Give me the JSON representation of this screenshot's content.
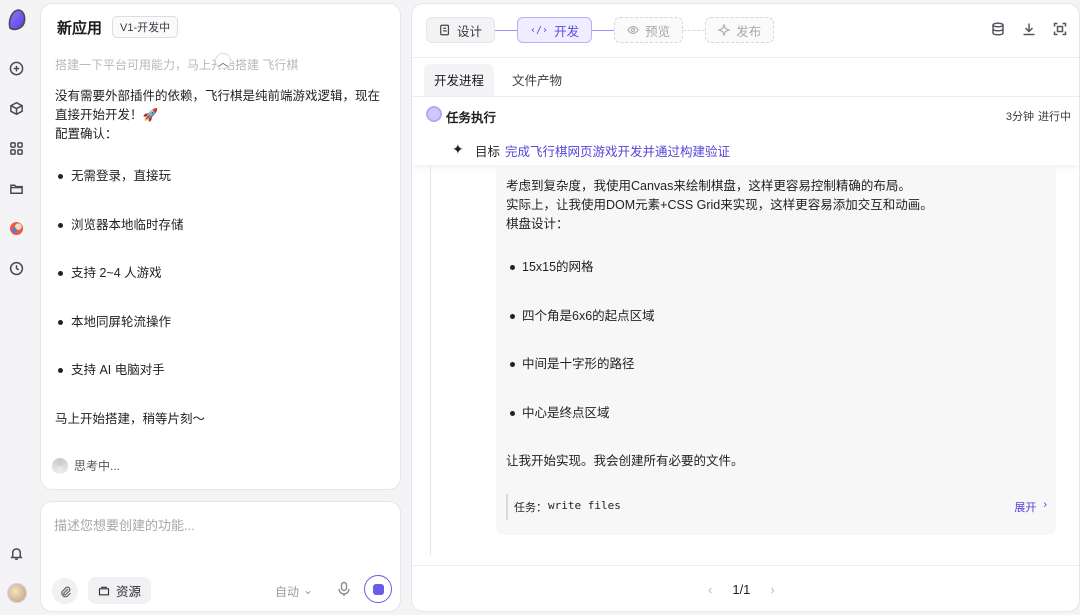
{
  "app": {
    "title": "新应用",
    "version_badge": "V1-开发中"
  },
  "chat": {
    "faded_line": "搭建一下平台可用能力，马上开始搭建 飞行棋",
    "message_intro": "没有需要外部插件的依赖，飞行棋是纯前端游戏逻辑，现在直接开始开发！🚀",
    "config_label": "配置确认：",
    "bullets": [
      "无需登录，直接玩",
      "浏览器本地临时存储",
      "支持 2~4 人游戏",
      "本地同屏轮流操作",
      "支持 AI 电脑对手"
    ],
    "closing": "马上开始搭建，稍等片刻～",
    "thinking": "思考中..."
  },
  "composer": {
    "placeholder": "描述您想要创建的功能...",
    "resource_label": "资源",
    "mode_label": "自动"
  },
  "steps": [
    {
      "label": "设计",
      "state": "done",
      "icon": "design-icon"
    },
    {
      "label": "开发",
      "state": "active",
      "icon": "code-icon"
    },
    {
      "label": "预览",
      "state": "pending",
      "icon": "eye-icon"
    },
    {
      "label": "发布",
      "state": "pending",
      "icon": "publish-icon"
    }
  ],
  "tabs": [
    {
      "label": "开发进程",
      "active": true
    },
    {
      "label": "文件产物",
      "active": false
    }
  ],
  "task": {
    "title": "任务执行",
    "time": "3分钟",
    "status": "进行中",
    "goal_label": "目标",
    "goal_text": "完成飞行棋网页游戏开发并通过构建验证"
  },
  "card": {
    "line1": "考虑到复杂度，我使用Canvas来绘制棋盘，这样更容易控制精确的布局。",
    "line2": "实际上，让我使用DOM元素+CSS Grid来实现，这样更容易添加交互和动画。",
    "line3": "棋盘设计：",
    "bullets": [
      "15x15的网格",
      "四个角是6x6的起点区域",
      "中间是十字形的路径",
      "中心是终点区域"
    ],
    "closing": "让我开始实现。我会创建所有必要的文件。",
    "task_key": "任务：",
    "task_value": "write files",
    "expand": "展开"
  },
  "pager": {
    "text": "1/1"
  },
  "colors": {
    "accent": "#5b4de0",
    "accent_light": "#efedff"
  }
}
